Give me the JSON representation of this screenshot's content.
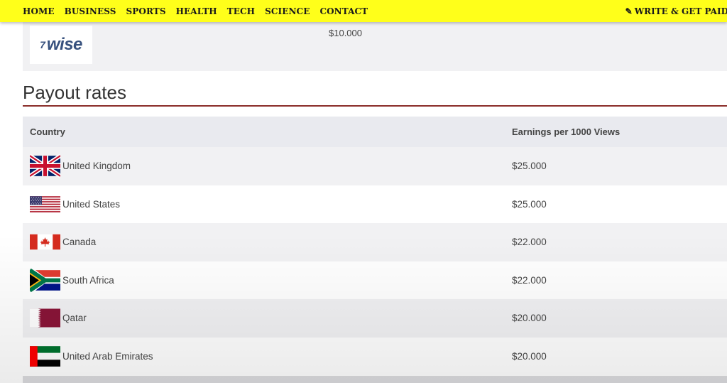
{
  "nav": {
    "items": [
      "HOME",
      "BUSINESS",
      "SPORTS",
      "HEALTH",
      "TECH",
      "SCIENCE",
      "CONTACT"
    ],
    "right_label": "WRITE & GET PAID",
    "background": "#ffff1a"
  },
  "wise": {
    "logo_text": "wise",
    "logo_mark": "7",
    "amount": "$10.000"
  },
  "section": {
    "title": "Payout rates",
    "rule_color": "#8b2e2a"
  },
  "table": {
    "headers": [
      "Country",
      "Earnings per 1000 Views"
    ],
    "rows": [
      {
        "country": "United Kingdom",
        "earnings": "$25.000",
        "flag": "uk-flag-icon"
      },
      {
        "country": "United States",
        "earnings": "$25.000",
        "flag": "us-flag-icon"
      },
      {
        "country": "Canada",
        "earnings": "$22.000",
        "flag": "canada-flag-icon"
      },
      {
        "country": "South Africa",
        "earnings": "$22.000",
        "flag": "south-africa-flag-icon"
      },
      {
        "country": "Qatar",
        "earnings": "$20.000",
        "flag": "qatar-flag-icon"
      },
      {
        "country": "United Arab Emirates",
        "earnings": "$20.000",
        "flag": "uae-flag-icon"
      }
    ]
  }
}
